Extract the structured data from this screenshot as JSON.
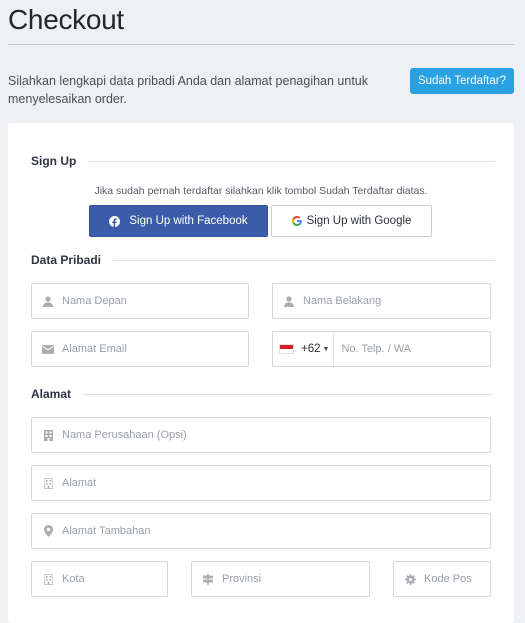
{
  "header": {
    "title": "Checkout",
    "intro": "Silahkan lengkapi data pribadi Anda dan alamat penagihan untuk menyelesaikan order.",
    "already_registered_label": "Sudah Terdaftar?"
  },
  "signup": {
    "heading": "Sign Up",
    "hint": "Jika sudah pernah terdaftar silahkan klik tombol Sudah Terdaftar diatas.",
    "facebook_label": "Sign Up with Facebook",
    "google_label": "Sign Up with Google"
  },
  "personal": {
    "heading": "Data Pribadi",
    "first_name_placeholder": "Nama Depan",
    "last_name_placeholder": "Nama Belakang",
    "email_placeholder": "Alamat Email",
    "phone_dial_code": "+62",
    "phone_placeholder": "No. Telp. / WA"
  },
  "address": {
    "heading": "Alamat",
    "company_placeholder": "Nama Perusahaan (Opsi)",
    "address_placeholder": "Alamat",
    "address2_placeholder": "Alamat Tambahan",
    "city_placeholder": "Kota",
    "province_placeholder": "Provinsi",
    "postcode_placeholder": "Kode Pos"
  },
  "colors": {
    "accent": "#2aa1e3",
    "facebook": "#3b5ca8",
    "background": "#eef0f3",
    "icon": "#a9aeb5"
  },
  "icons": {
    "first_name": "user-icon",
    "last_name": "user-icon",
    "email": "envelope-icon",
    "company": "building-icon",
    "address": "building-icon",
    "address2": "map-marker-icon",
    "city": "building-icon",
    "province": "signpost-icon",
    "postcode": "gear-icon"
  }
}
